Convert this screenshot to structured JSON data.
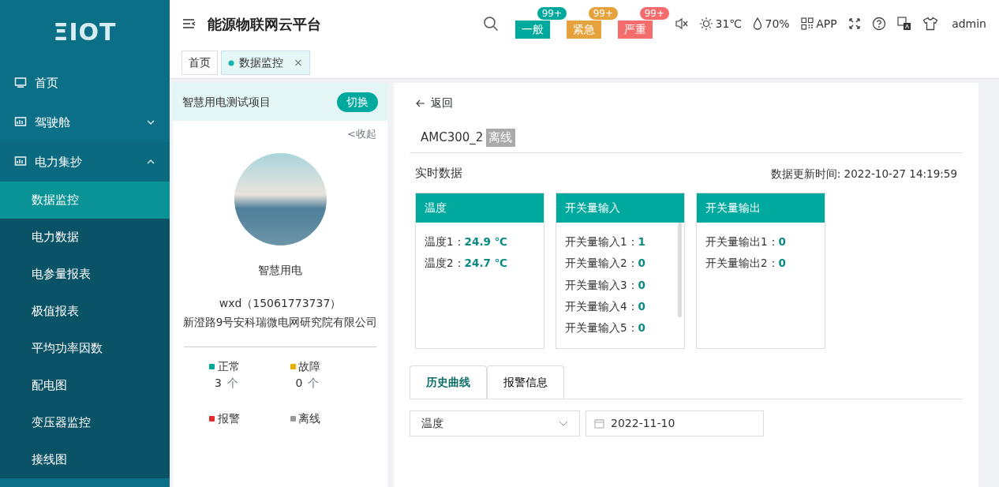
{
  "logo": "ΞIOT",
  "sidebar": {
    "items": [
      {
        "label": "首页",
        "selected": false
      },
      {
        "label": "驾驶舱",
        "expanded": false,
        "selected": false
      },
      {
        "label": "电力集抄",
        "expanded": true,
        "selected": false,
        "children": [
          {
            "label": "数据监控",
            "selected": true
          },
          {
            "label": "电力数据",
            "selected": false
          },
          {
            "label": "电参量报表",
            "selected": false
          },
          {
            "label": "极值报表",
            "selected": false
          },
          {
            "label": "平均功率因数",
            "selected": false
          },
          {
            "label": "配电图",
            "selected": false
          },
          {
            "label": "变压器监控",
            "selected": false
          },
          {
            "label": "接线图",
            "selected": false
          }
        ]
      }
    ]
  },
  "header": {
    "title": "能源物联网云平台",
    "alarms": [
      {
        "label": "一般",
        "count": "99+",
        "color": "#00a99d"
      },
      {
        "label": "紧急",
        "count": "99+",
        "color": "#e6a23c"
      },
      {
        "label": "严重",
        "count": "99+",
        "color": "#f56c6c"
      }
    ],
    "temperature": "31℃",
    "humidity": "70%",
    "app": "APP",
    "user": "admin"
  },
  "tabs": [
    {
      "label": "首页",
      "selected": false
    },
    {
      "label": "数据监控",
      "selected": true,
      "close": "×"
    }
  ],
  "project": {
    "name": "智慧用电测试项目",
    "switch_button": "切换",
    "collapse": "<收起",
    "title": "智慧用电",
    "contact": "wxd（15061773737）",
    "address": "新澄路9号安科瑞微电网研究院有限公司",
    "statuses": [
      {
        "label": "正常",
        "count": "3",
        "unit": "个",
        "color": "#00a99d"
      },
      {
        "label": "故障",
        "count": "0",
        "unit": "个",
        "color": "#e6b000"
      },
      {
        "label": "报警",
        "color": "#e02b2b"
      },
      {
        "label": "离线",
        "color": "#999999"
      }
    ]
  },
  "detail": {
    "back": "返回",
    "device": "AMC300_2",
    "device_status": "离线",
    "section": "实时数据",
    "update_time": "数据更新时间: 2022-10-27 14:19:59",
    "cards": [
      {
        "title": "温度",
        "scroll": false,
        "rows": [
          {
            "label": "温度1：",
            "value": "24.9 ℃"
          },
          {
            "label": "温度2：",
            "value": "24.7 ℃"
          }
        ]
      },
      {
        "title": "开关量输入",
        "scroll": true,
        "rows": [
          {
            "label": "开关量输入1：",
            "value": "1"
          },
          {
            "label": "开关量输入2：",
            "value": "0"
          },
          {
            "label": "开关量输入3：",
            "value": "0"
          },
          {
            "label": "开关量输入4：",
            "value": "0"
          },
          {
            "label": "开关量输入5：",
            "value": "0"
          }
        ]
      },
      {
        "title": "开关量输出",
        "scroll": false,
        "rows": [
          {
            "label": "开关量输出1：",
            "value": "0"
          },
          {
            "label": "开关量输出2：",
            "value": "0"
          }
        ]
      }
    ],
    "history_tabs": [
      {
        "label": "历史曲线",
        "selected": true
      },
      {
        "label": "报警信息",
        "selected": false
      }
    ],
    "metric_select": "温度",
    "date": "2022-11-10"
  }
}
